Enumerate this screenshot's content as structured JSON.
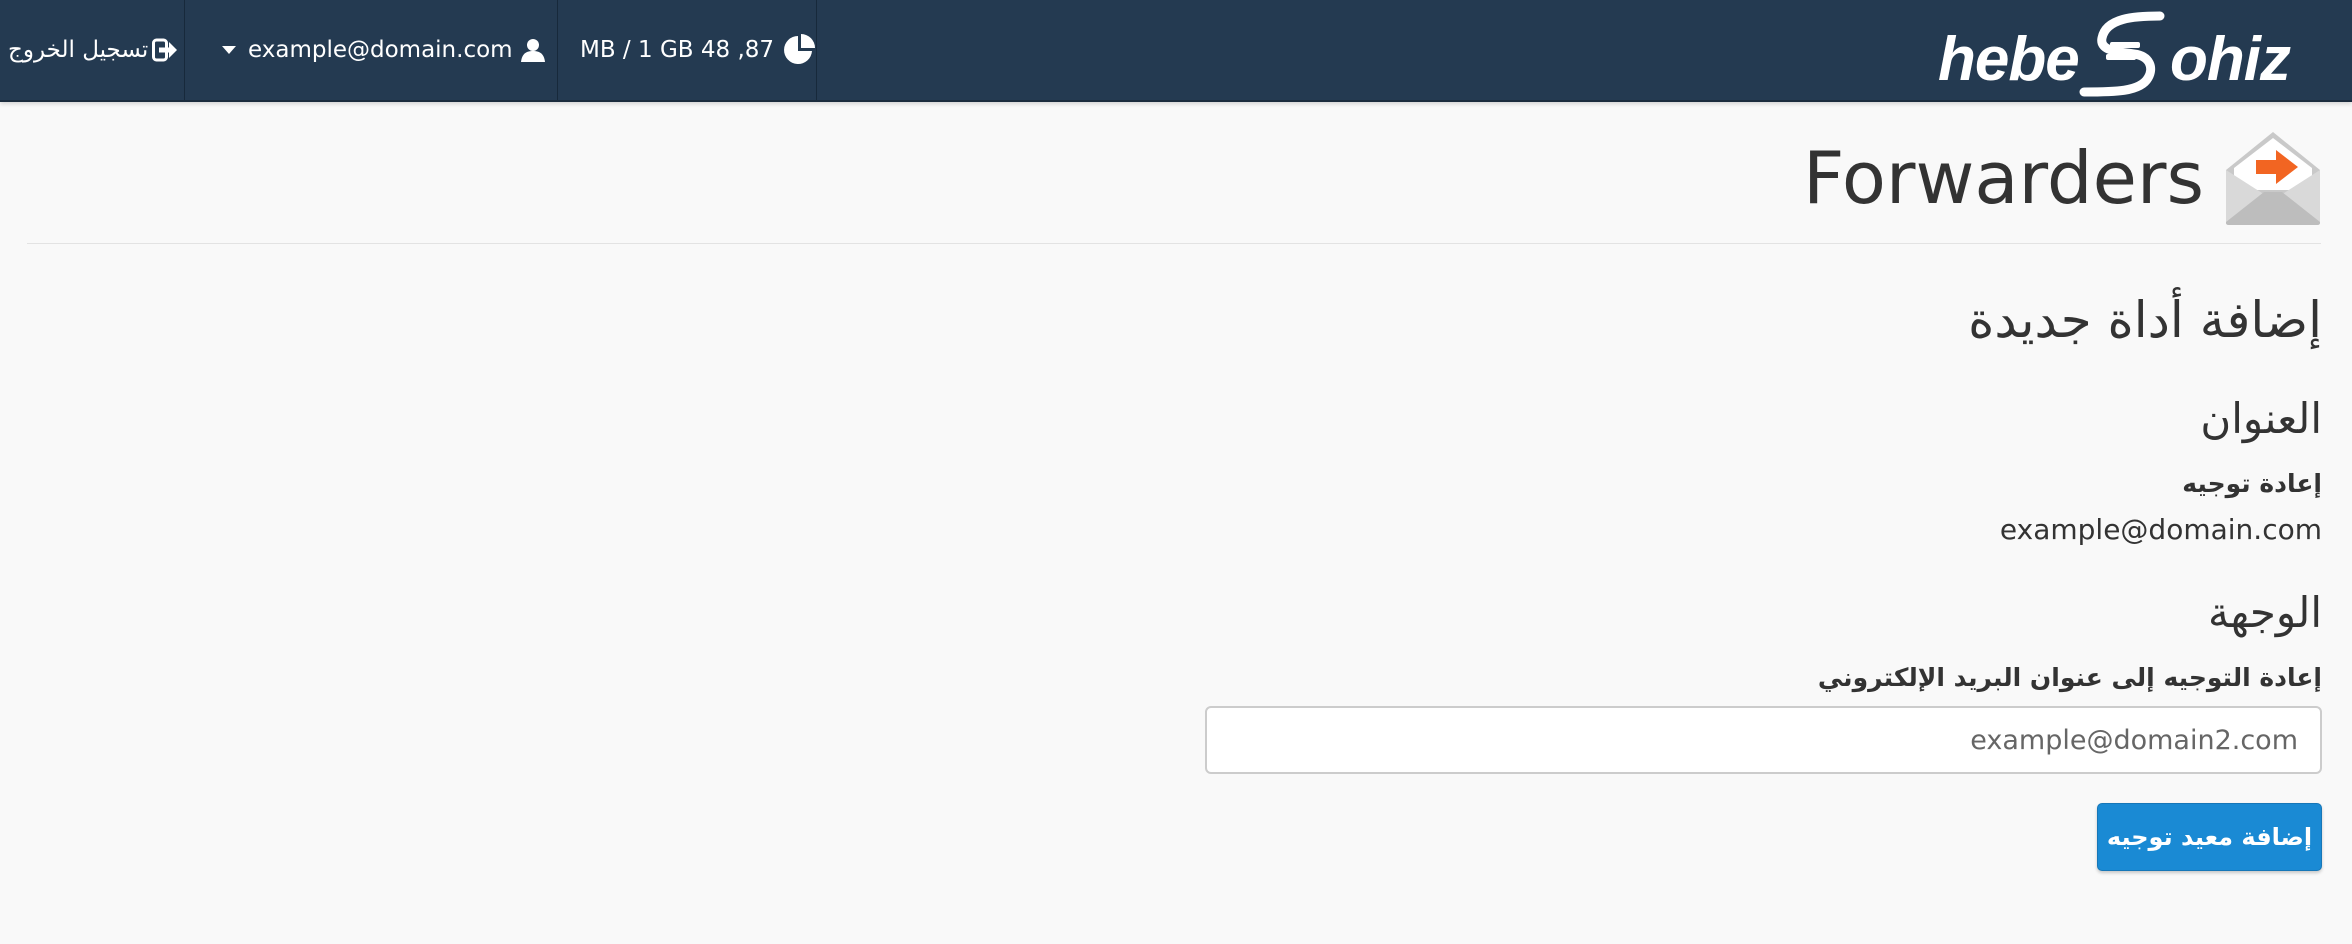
{
  "topbar": {
    "logout_label": "تسجيل الخروج",
    "user_email": "example@domain.com",
    "disk_usage": "87, 48 MB / 1 GB",
    "logo_text": "hebeSjohiz",
    "background": "#243a51"
  },
  "page": {
    "title": "Forwarders"
  },
  "form": {
    "heading": "إضافة أداة جديدة",
    "address_section_title": "العنوان",
    "address_label": "إعادة توجيه",
    "address_value": "example@domain.com",
    "destination_section_title": "الوجهة",
    "destination_label": "إعادة التوجيه إلى عنوان البريد الإلكتروني",
    "destination_placeholder": "example@domain2.com",
    "submit_label": "إضافة معيد توجيه",
    "submit_color": "#1a8ad4"
  },
  "icons": {
    "logout": "sign-out-icon",
    "user": "user-icon",
    "chevron": "caret-down-icon",
    "usage": "pie-chart-icon",
    "page": "envelope-forward-icon"
  }
}
